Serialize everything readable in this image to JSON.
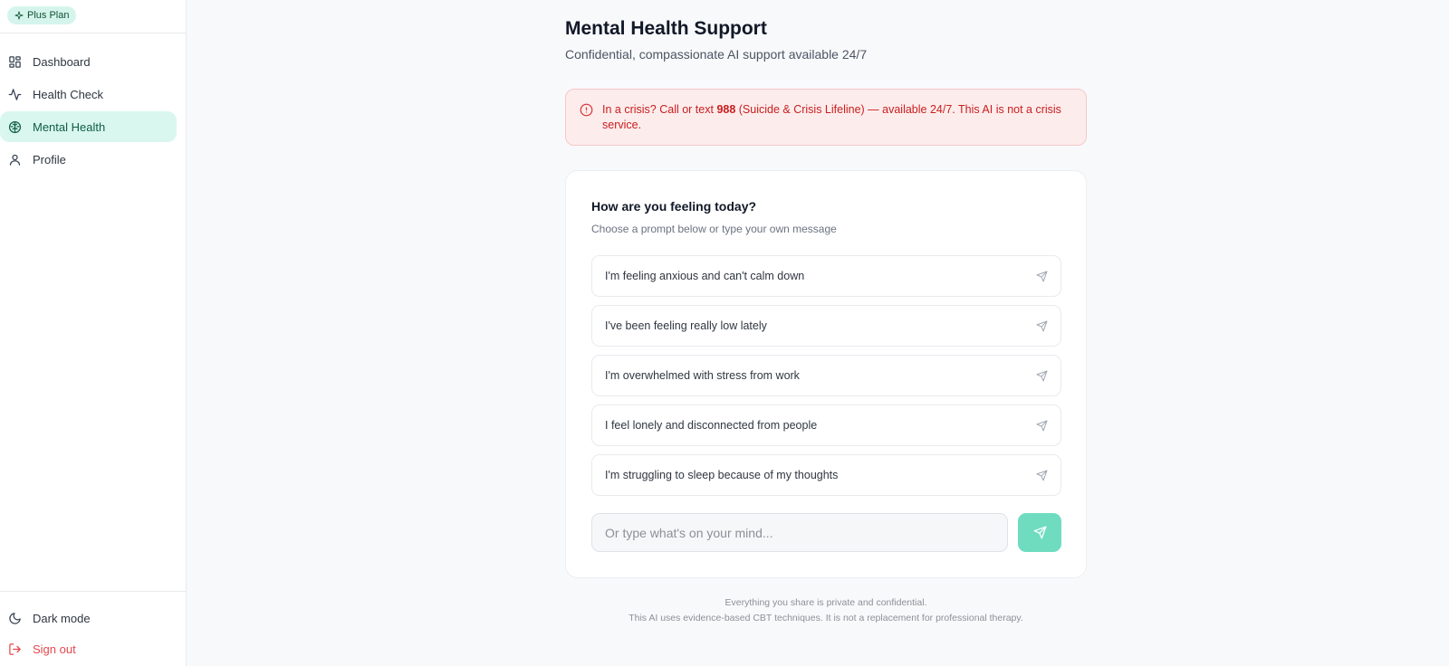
{
  "sidebar": {
    "plan_badge": "Plus Plan",
    "items": [
      {
        "label": "Dashboard",
        "icon": "dashboard-icon"
      },
      {
        "label": "Health Check",
        "icon": "activity-icon"
      },
      {
        "label": "Mental Health",
        "icon": "brain-icon",
        "active": true
      },
      {
        "label": "Profile",
        "icon": "user-icon"
      }
    ],
    "dark_mode_label": "Dark mode",
    "sign_out_label": "Sign out"
  },
  "header": {
    "title": "Mental Health Support",
    "subtitle": "Confidential, compassionate AI support available 24/7"
  },
  "crisis_banner": {
    "prefix": "In a crisis? Call or text ",
    "number": "988",
    "suffix": " (Suicide & Crisis Lifeline) — available 24/7. This AI is not a crisis service.",
    "icon": "alert-circle-icon"
  },
  "card": {
    "title": "How are you feeling today?",
    "subtitle": "Choose a prompt below or type your own message",
    "prompts": [
      "I'm feeling anxious and can't calm down",
      "I've been feeling really low lately",
      "I'm overwhelmed with stress from work",
      "I feel lonely and disconnected from people",
      "I'm struggling to sleep because of my thoughts"
    ],
    "input_placeholder": "Or type what's on your mind...",
    "input_value": ""
  },
  "footer": {
    "line1": "Everything you share is private and confidential.",
    "line2": "This AI uses evidence-based CBT techniques. It is not a replacement for professional therapy."
  },
  "colors": {
    "accent": "#6fdcc0",
    "active_nav_bg": "#d9f7ee",
    "crisis_bg": "#fdecec",
    "crisis_text": "#c81e1e",
    "sign_out": "#e5484d"
  }
}
